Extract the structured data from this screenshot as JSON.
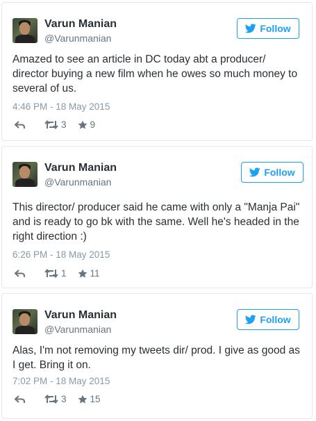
{
  "colors": {
    "accent": "#1da1f2",
    "muted": "#8899a6",
    "text": "#292f33",
    "border": "#e1e8ed"
  },
  "tweets": [
    {
      "name": "Varun Manian",
      "handle": "@Varunmanian",
      "follow_label": "Follow",
      "text": "Amazed to see an article in DC today abt a producer/ director buying a new film when he owes so much money to several of us.",
      "timestamp": "4:46 PM - 18 May 2015",
      "retweets": "3",
      "favorites": "9"
    },
    {
      "name": "Varun Manian",
      "handle": "@Varunmanian",
      "follow_label": "Follow",
      "text": "This director/ producer said he came with only a \"Manja Pai\" and is ready to go bk with the same. Well he's headed in the right direction :)",
      "timestamp": "6:26 PM - 18 May 2015",
      "retweets": "1",
      "favorites": "11"
    },
    {
      "name": "Varun Manian",
      "handle": "@Varunmanian",
      "follow_label": "Follow",
      "text": "Alas, I'm not removing my tweets dir/ prod. I give as good as I get. Bring it on.",
      "timestamp": "7:02 PM - 18 May 2015",
      "retweets": "3",
      "favorites": "15"
    }
  ]
}
